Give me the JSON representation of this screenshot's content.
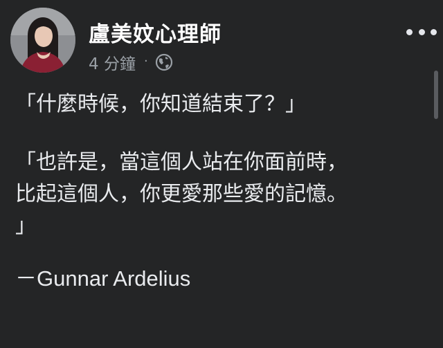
{
  "post": {
    "author_name": "盧美妏心理師",
    "timestamp": "4 分鐘",
    "separator": "·",
    "privacy_icon": "globe-icon",
    "more_icon": "more-options-icon",
    "body": {
      "line1": "「什麼時候，你知道結束了？」",
      "line2": "「也許是，當這個人站在你面前時，",
      "line3": "比起這個人，你更愛那些愛的記憶。",
      "line4": "」",
      "line5": "－Gunnar Ardelius"
    }
  },
  "colors": {
    "background": "#242526",
    "text_primary": "#e4e6eb",
    "text_secondary": "#9aa0a6"
  }
}
